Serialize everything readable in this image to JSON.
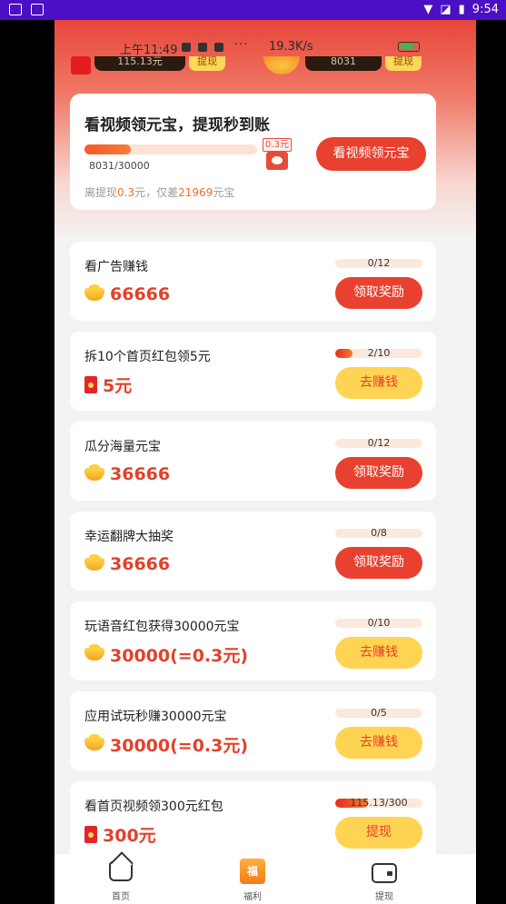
{
  "outer_status": {
    "time": "9:54"
  },
  "inner_status": {
    "time": "上午11:49",
    "dots": "···",
    "speed": "19.3K/s"
  },
  "balance_strip": {
    "cash": "115.13元",
    "cash_btn": "提现",
    "coins": "8031",
    "coins_btn": "提现"
  },
  "main_card": {
    "title": "看视频领元宝，提现秒到账",
    "progress": {
      "current": 8031,
      "total": 30000,
      "label": "8031/30000"
    },
    "withdraw_amount": "0.3元",
    "button": "看视频领元宝",
    "remain_prefix": "离提现",
    "remain_amount": "0.3",
    "remain_mid": "元，仅差",
    "remain_coins": "21969",
    "remain_suffix": "元宝"
  },
  "tasks": [
    {
      "title": "看广告赚钱",
      "reward": "66666",
      "reward_icon": "ingot-icon",
      "progress_label": "0/12",
      "progress_fraction": 0.0,
      "button": "领取奖励",
      "button_style": "red"
    },
    {
      "title": "拆10个首页红包领5元",
      "reward": "5元",
      "reward_icon": "redpack-icon",
      "progress_label": "2/10",
      "progress_fraction": 0.2,
      "button": "去赚钱",
      "button_style": "yellow"
    },
    {
      "title": "瓜分海量元宝",
      "reward": "36666",
      "reward_icon": "ingot-icon",
      "progress_label": "0/12",
      "progress_fraction": 0.0,
      "button": "领取奖励",
      "button_style": "red"
    },
    {
      "title": "幸运翻牌大抽奖",
      "reward": "36666",
      "reward_icon": "ingot-icon",
      "progress_label": "0/8",
      "progress_fraction": 0.0,
      "button": "领取奖励",
      "button_style": "red"
    },
    {
      "title": "玩语音红包获得30000元宝",
      "reward": "30000(=0.3元)",
      "reward_icon": "ingot-icon",
      "progress_label": "0/10",
      "progress_fraction": 0.0,
      "button": "去赚钱",
      "button_style": "yellow"
    },
    {
      "title": "应用试玩秒赚30000元宝",
      "reward": "30000(=0.3元)",
      "reward_icon": "ingot-icon",
      "progress_label": "0/5",
      "progress_fraction": 0.0,
      "button": "去赚钱",
      "button_style": "yellow"
    },
    {
      "title": "看首页视频领300元红包",
      "reward": "300元",
      "reward_icon": "redpack-icon",
      "progress_label": "115.13/300",
      "progress_fraction": 0.38,
      "button": "提现",
      "button_style": "yellow"
    }
  ],
  "bottom_nav": [
    {
      "label": "首页",
      "icon": "home-icon"
    },
    {
      "label": "福利",
      "icon": "welfare-icon",
      "icon_text": "福"
    },
    {
      "label": "提现",
      "icon": "wallet-icon"
    }
  ]
}
